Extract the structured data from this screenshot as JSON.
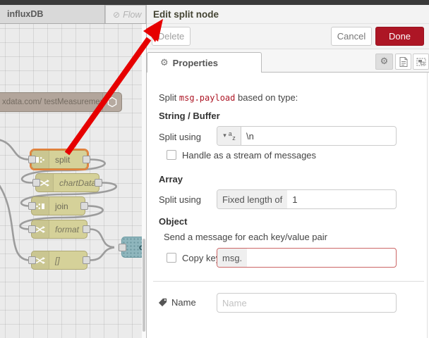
{
  "workspace": {
    "tabs": [
      {
        "label": "influxDB",
        "state": "active"
      },
      {
        "label": "Flow",
        "state": "disabled",
        "icon": "circle-slash"
      }
    ],
    "nodes": {
      "influx": {
        "label": "xdata.com/ testMeasurement",
        "icon": "hexagon-icon"
      },
      "split": {
        "label": "split",
        "selected": true,
        "icon": "split-icon"
      },
      "chartData": {
        "label": "chartData",
        "icon": "shuffle-icon"
      },
      "join": {
        "label": "join",
        "icon": "join-icon"
      },
      "format": {
        "label": "format",
        "icon": "shuffle-icon"
      },
      "bracket": {
        "label": "[]",
        "icon": "shuffle-icon"
      },
      "chart": {
        "label": "c",
        "icon": "dotted-texture"
      }
    }
  },
  "panel": {
    "title": "Edit split node",
    "toolbar": {
      "delete": "Delete",
      "cancel": "Cancel",
      "done": "Done"
    },
    "tabs": {
      "properties": "Properties"
    },
    "side_buttons": [
      "gear-icon",
      "description-icon",
      "appearance-icon"
    ],
    "intro": {
      "prefix": "Split ",
      "code": "msg.payload",
      "suffix": " based on type:"
    },
    "string_buffer": {
      "heading": "String / Buffer",
      "split_using_label": "Split using",
      "type_glyph_a": "a",
      "type_glyph_z": "z",
      "caret": "▾",
      "value": "\\n",
      "stream_checkbox_label": "Handle as a stream of messages",
      "stream_checkbox_checked": false
    },
    "array": {
      "heading": "Array",
      "split_using_label": "Split using",
      "prefix": "Fixed length of",
      "value": "1"
    },
    "object": {
      "heading": "Object",
      "description": "Send a message for each key/value pair",
      "copy_key_label": "Copy key to",
      "copy_key_checked": false,
      "key_prefix": "msg.",
      "key_value": ""
    },
    "name": {
      "label": "Name",
      "placeholder": "Name",
      "value": ""
    }
  },
  "colors": {
    "accent_red": "#AD1625",
    "selection_orange": "#E2813C",
    "arrow_red": "#E60000",
    "error_border": "#CC6666",
    "node_khaki": "#D5D199",
    "node_influx_tan": "#B2A59B",
    "node_chart_teal": "#8FB6BD"
  }
}
